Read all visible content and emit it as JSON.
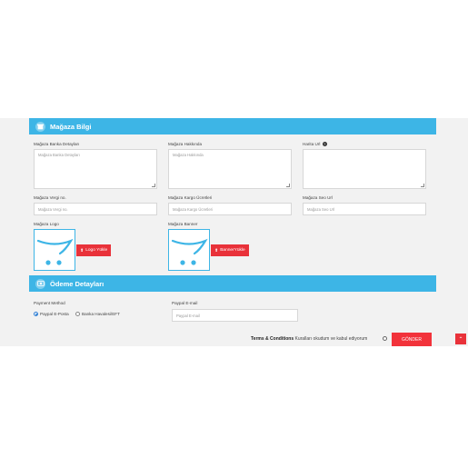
{
  "store_info": {
    "title": "Mağaza Bilgi",
    "bank_details_label": "Mağaza Banka Detayları",
    "bank_details_placeholder": "Mağaza Banka Detayları",
    "about_label": "Mağaza Hakkında",
    "about_placeholder": "Mağaza Hakkında",
    "map_url_label": "Harita Url",
    "map_url_placeholder": "",
    "tax_label": "Mağaza Vergi no.",
    "tax_placeholder": "Mağaza Vergi no.",
    "shipping_label": "Mağaza Kargo Ücretleri",
    "shipping_placeholder": "Mağaza Kargo Ücretleri",
    "seo_label": "Mağaza Seo Url",
    "seo_placeholder": "Mağaza Seo Url",
    "logo_label": "Mağaza Logo",
    "logo_button": "Logo Yükle",
    "banner_label": "Mağaza Banner",
    "banner_button": "BannerYükle"
  },
  "payment": {
    "title": "Ödeme Detayları",
    "method_label": "Payment Method",
    "options": [
      "Paypal E-Posta",
      "Banka Havalesi/EFT"
    ],
    "selected": "Paypal E-Posta",
    "paypal_label": "Paypal E-mail",
    "paypal_placeholder": "Paypal E-mail"
  },
  "footer": {
    "terms_link": "Terms & Conditions",
    "terms_text": "Kuralları okudum ve kabul ediyorum",
    "submit": "GÖNDER",
    "scroll_top_icon": "chevron-up-icon"
  },
  "colors": {
    "section_bar": "#3db5e6",
    "button_red": "#e9323a",
    "cart_logo_blue": "#3db5e6"
  }
}
